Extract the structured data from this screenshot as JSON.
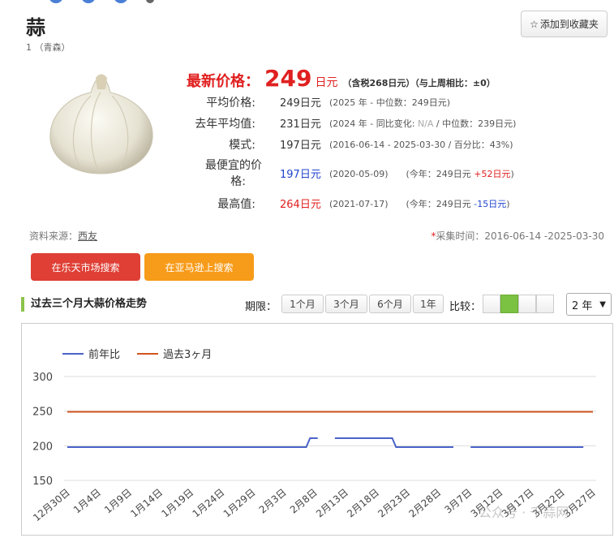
{
  "product": {
    "title": "蒜",
    "subtitle": "1 （青森）",
    "favorite_label": "添加到收藏夹"
  },
  "latest": {
    "label": "最新价格：",
    "price": "249",
    "unit": "日元",
    "detail": "（含税268日元）（与上周相比：±0）"
  },
  "stats": [
    {
      "key": "平均价格:",
      "value": "249日元",
      "note": "(2025 年 - 中位数：249日元)"
    },
    {
      "key": "去年平均值:",
      "value": "231日元",
      "note_pre": "(2024 年 - 同比变化: ",
      "note_gray": "N/A",
      "note_post": " / 中位数：239日元)"
    },
    {
      "key": "模式:",
      "value": "197日元",
      "note": "(2016-06-14 - 2025-03-30 / 百分比：43%)"
    },
    {
      "key_line1": "最便宜的价",
      "key_line2": "格:",
      "value": "197日元",
      "note_pre": "(2020-05-09)　　(今年：249日元 ",
      "note_delta": "+52日元",
      "note_post": ")"
    },
    {
      "key": "最高值:",
      "value": "264日元",
      "note_pre": "(2021-07-17)　　(今年：249日元 ",
      "note_delta": "-15日元",
      "note_post": ")"
    }
  ],
  "source": {
    "label": "资料来源：",
    "link": "西友"
  },
  "collect_time": "采集时间：2016-06-14 -2025-03-30",
  "buttons": {
    "rakuten": "在乐天市场搜索",
    "amazon": "在亚马逊上搜索"
  },
  "section_title": "过去三个月大蒜价格走势",
  "period": {
    "label": "期限：",
    "options": [
      "1个月",
      "3个月",
      "6个月",
      "1年"
    ]
  },
  "compare": {
    "label": "比较：",
    "active_index": 1
  },
  "year_select": "2 年",
  "watermark": "公众号 · 千蒜网",
  "colors": {
    "accent_red": "#e02020",
    "rakuten": "#df3f35",
    "amazon": "#f79b1a",
    "prev_year": "#4a63c8",
    "past3m": "#d2541f"
  },
  "chart_data": {
    "type": "line",
    "legend": [
      "前年比",
      "過去3ヶ月"
    ],
    "ylim": [
      150,
      300
    ],
    "yticks": [
      150,
      200,
      250,
      300
    ],
    "xticks": [
      "12月30日",
      "1月4日",
      "1月9日",
      "1月14日",
      "1月19日",
      "1月24日",
      "1月29日",
      "2月3日",
      "2月8日",
      "2月13日",
      "2月18日",
      "2月23日",
      "2月28日",
      "3月7日",
      "3月12日",
      "3月17日",
      "3月22日",
      "3月27日"
    ],
    "series": [
      {
        "name": "前年比",
        "points": [
          [
            0,
            198
          ],
          [
            12.5,
            198
          ],
          [
            12.7,
            211
          ],
          [
            13.1,
            211
          ],
          null,
          [
            14,
            211
          ],
          [
            17,
            211
          ],
          [
            17.2,
            198
          ],
          [
            20.2,
            198
          ],
          null,
          [
            21.1,
            198
          ],
          [
            27,
            198
          ]
        ]
      },
      {
        "name": "過去3ヶ月",
        "points": [
          [
            0,
            249
          ],
          [
            27.5,
            249
          ]
        ]
      }
    ]
  }
}
